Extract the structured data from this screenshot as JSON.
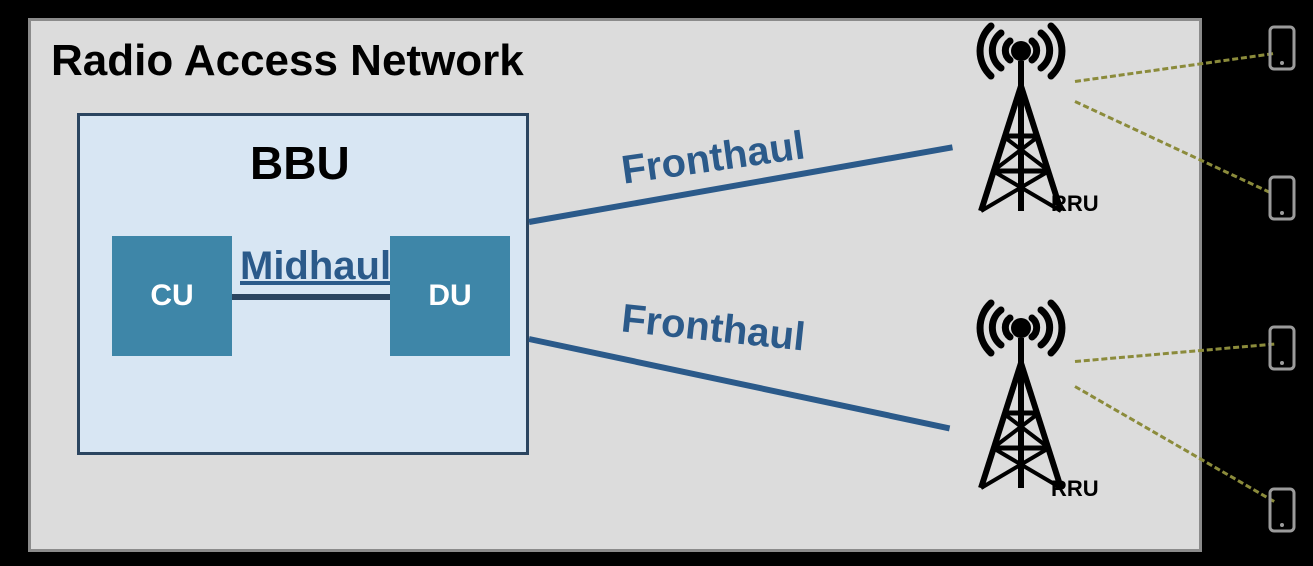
{
  "title": "Radio Access Network",
  "bbu": {
    "title": "BBU",
    "cu_label": "CU",
    "du_label": "DU",
    "midhaul_label": "Midhaul"
  },
  "fronthaul": {
    "label": "Fronthaul"
  },
  "rru": {
    "label": "RRU"
  }
}
